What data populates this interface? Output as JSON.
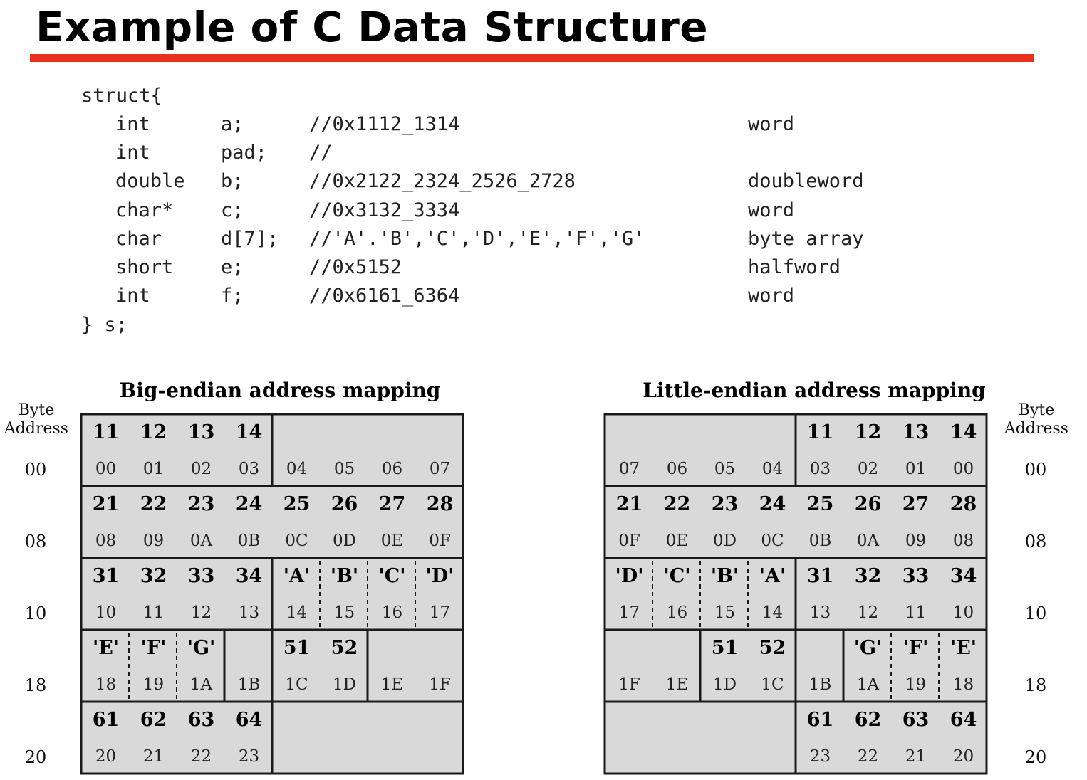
{
  "title": "Example of C Data Structure",
  "colors": {
    "rule": "#e8321e",
    "cell_fill": "#d9d9d9",
    "border": "#1a1a1a"
  },
  "code": {
    "open": "struct{",
    "close": "} s;",
    "fields": [
      {
        "type": "int",
        "name": "a;",
        "comment": "//0x1112_1314",
        "size": "word"
      },
      {
        "type": "int",
        "name": "pad;",
        "comment": "//",
        "size": ""
      },
      {
        "type": "double",
        "name": "b;",
        "comment": "//0x2122_2324_2526_2728",
        "size": "doubleword"
      },
      {
        "type": "char*",
        "name": "c;",
        "comment": "//0x3132_3334",
        "size": "word"
      },
      {
        "type": "char",
        "name": "d[7];",
        "comment": "//'A'.'B','C','D','E','F','G'",
        "size": "byte array"
      },
      {
        "type": "short",
        "name": "e;",
        "comment": "//0x5152",
        "size": "halfword"
      },
      {
        "type": "int",
        "name": "f;",
        "comment": "//0x6161_6364",
        "size": "word"
      }
    ]
  },
  "big_endian": {
    "title": "Big-endian address mapping",
    "byte_address_label": [
      "Byte",
      "Address"
    ],
    "row_addresses": [
      "00",
      "08",
      "10",
      "18",
      "20"
    ],
    "rows": [
      {
        "values": [
          "11",
          "12",
          "13",
          "14",
          "",
          "",
          "",
          ""
        ],
        "addrs": [
          "00",
          "01",
          "02",
          "03",
          "04",
          "05",
          "06",
          "07"
        ],
        "groups": [
          [
            0,
            3
          ],
          [
            4,
            7
          ]
        ]
      },
      {
        "values": [
          "21",
          "22",
          "23",
          "24",
          "25",
          "26",
          "27",
          "28"
        ],
        "addrs": [
          "08",
          "09",
          "0A",
          "0B",
          "0C",
          "0D",
          "0E",
          "0F"
        ],
        "groups": [
          [
            0,
            7
          ]
        ]
      },
      {
        "values": [
          "31",
          "32",
          "33",
          "34",
          "'A'",
          "'B'",
          "'C'",
          "'D'"
        ],
        "addrs": [
          "10",
          "11",
          "12",
          "13",
          "14",
          "15",
          "16",
          "17"
        ],
        "groups": [
          [
            0,
            3
          ],
          [
            4,
            7
          ]
        ],
        "dashed": [
          5,
          6,
          7
        ]
      },
      {
        "values": [
          "'E'",
          "'F'",
          "'G'",
          "",
          "51",
          "52",
          "",
          ""
        ],
        "addrs": [
          "18",
          "19",
          "1A",
          "1B",
          "1C",
          "1D",
          "1E",
          "1F"
        ],
        "groups": [
          [
            0,
            2
          ],
          [
            3,
            3
          ],
          [
            4,
            5
          ],
          [
            6,
            7
          ]
        ],
        "dashed": [
          1,
          2
        ]
      },
      {
        "values": [
          "61",
          "62",
          "63",
          "64",
          "",
          "",
          "",
          ""
        ],
        "addrs": [
          "20",
          "21",
          "22",
          "23",
          "",
          "",
          "",
          ""
        ],
        "groups": [
          [
            0,
            3
          ],
          [
            4,
            7
          ]
        ]
      }
    ]
  },
  "little_endian": {
    "title": "Little-endian address mapping",
    "byte_address_label": [
      "Byte",
      "Address"
    ],
    "row_addresses": [
      "00",
      "08",
      "10",
      "18",
      "20"
    ],
    "rows": [
      {
        "values": [
          "",
          "",
          "",
          "",
          "11",
          "12",
          "13",
          "14"
        ],
        "addrs": [
          "07",
          "06",
          "05",
          "04",
          "03",
          "02",
          "01",
          "00"
        ],
        "groups": [
          [
            0,
            3
          ],
          [
            4,
            7
          ]
        ]
      },
      {
        "values": [
          "21",
          "22",
          "23",
          "24",
          "25",
          "26",
          "27",
          "28"
        ],
        "addrs": [
          "0F",
          "0E",
          "0D",
          "0C",
          "0B",
          "0A",
          "09",
          "08"
        ],
        "groups": [
          [
            0,
            7
          ]
        ]
      },
      {
        "values": [
          "'D'",
          "'C'",
          "'B'",
          "'A'",
          "31",
          "32",
          "33",
          "34"
        ],
        "addrs": [
          "17",
          "16",
          "15",
          "14",
          "13",
          "12",
          "11",
          "10"
        ],
        "groups": [
          [
            0,
            3
          ],
          [
            4,
            7
          ]
        ],
        "dashed": [
          1,
          2,
          3
        ]
      },
      {
        "values": [
          "",
          "",
          "51",
          "52",
          "",
          "'G'",
          "'F'",
          "'E'"
        ],
        "addrs": [
          "1F",
          "1E",
          "1D",
          "1C",
          "1B",
          "1A",
          "19",
          "18"
        ],
        "groups": [
          [
            0,
            1
          ],
          [
            2,
            3
          ],
          [
            4,
            4
          ],
          [
            5,
            7
          ]
        ],
        "dashed": [
          6,
          7
        ]
      },
      {
        "values": [
          "",
          "",
          "",
          "",
          "61",
          "62",
          "63",
          "64"
        ],
        "addrs": [
          "",
          "",
          "",
          "",
          "23",
          "22",
          "21",
          "20"
        ],
        "groups": [
          [
            0,
            3
          ],
          [
            4,
            7
          ]
        ]
      }
    ]
  }
}
